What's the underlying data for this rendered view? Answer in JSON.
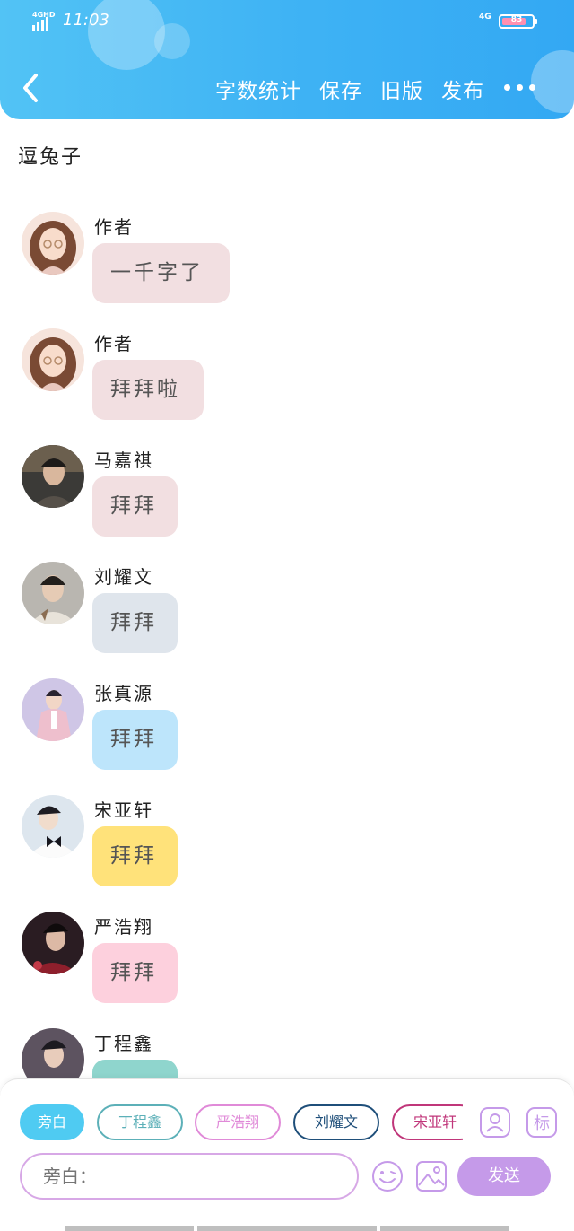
{
  "status_bar": {
    "signal_label": "4GHD",
    "time": "11:03",
    "network": "4G",
    "battery": "83"
  },
  "header": {
    "nav": [
      "字数统计",
      "保存",
      "旧版",
      "发布"
    ]
  },
  "story": {
    "title": "逗兔子"
  },
  "messages": [
    {
      "speaker": "作者",
      "text": "一千字了",
      "bubble_color": "#f2dfe1"
    },
    {
      "speaker": "作者",
      "text": "拜拜啦",
      "bubble_color": "#f2dfe1"
    },
    {
      "speaker": "马嘉祺",
      "text": "拜拜",
      "bubble_color": "#f2dfe1"
    },
    {
      "speaker": "刘耀文",
      "text": "拜拜",
      "bubble_color": "#dfe5ec"
    },
    {
      "speaker": "张真源",
      "text": "拜拜",
      "bubble_color": "#bde5fb"
    },
    {
      "speaker": "宋亚轩",
      "text": "拜拜",
      "bubble_color": "#ffe27a"
    },
    {
      "speaker": "严浩翔",
      "text": "拜拜",
      "bubble_color": "#fdd0dd"
    },
    {
      "speaker": "丁程鑫",
      "text": "",
      "bubble_color": "#8fd5cd"
    }
  ],
  "composer": {
    "roles": [
      {
        "label": "旁白",
        "color": "#4fcbf2",
        "active": true
      },
      {
        "label": "丁程鑫",
        "color": "#5cb0b8",
        "active": false
      },
      {
        "label": "严浩翔",
        "color": "#e08ad8",
        "active": false
      },
      {
        "label": "刘耀文",
        "color": "#1f4f7a",
        "active": false
      },
      {
        "label": "宋亚轩",
        "color": "#c0367a",
        "active": false
      }
    ],
    "tag_icon_label": "标",
    "input_placeholder": "旁白：",
    "send_label": "发送"
  }
}
